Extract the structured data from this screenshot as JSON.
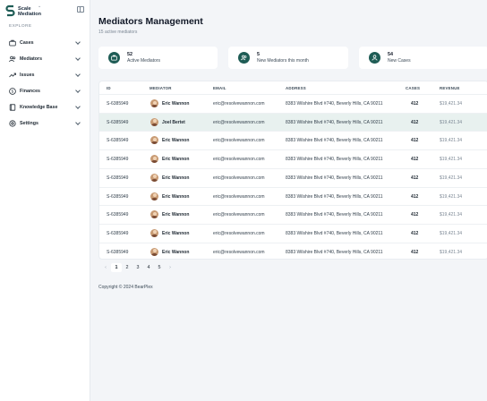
{
  "brand": {
    "line1": "Scale",
    "line2": "Mediation"
  },
  "sidebar": {
    "section_label": "EXPLORE",
    "items": [
      {
        "label": "Cases",
        "icon": "briefcase-icon"
      },
      {
        "label": "Mediators",
        "icon": "users-icon"
      },
      {
        "label": "Issues",
        "icon": "trending-icon"
      },
      {
        "label": "Finances",
        "icon": "dollar-icon"
      },
      {
        "label": "Knowledge Base",
        "icon": "book-icon"
      },
      {
        "label": "Settings",
        "icon": "gear-icon"
      }
    ]
  },
  "header": {
    "title": "Mediators Management",
    "subtitle": "15 active mediators"
  },
  "stats": [
    {
      "value": "52",
      "label": "Active Mediators",
      "icon": "briefcase-icon"
    },
    {
      "value": "5",
      "label": "New Mediators this month",
      "icon": "users-icon"
    },
    {
      "value": "54",
      "label": "New Cases",
      "icon": "person-icon"
    }
  ],
  "table": {
    "columns": {
      "id": "ID",
      "mediator": "MEDIATOR",
      "email": "EMAIL",
      "address": "ADDRESS",
      "cases": "CASES",
      "revenue": "REVENUE"
    },
    "rows": [
      {
        "id": "S-6385949",
        "name": "Eric Wannon",
        "email": "eric@resolvewannon.com",
        "address": "8383 Wilshire Blvd #740, Beverly Hills, CA 90211",
        "cases": "412",
        "revenue": "$19,421.34"
      },
      {
        "id": "S-6385949",
        "name": "Joel Bertet",
        "email": "eric@resolvewannon.com",
        "address": "8383 Wilshire Blvd #740, Beverly Hills, CA 90211",
        "cases": "412",
        "revenue": "$19,421.34"
      },
      {
        "id": "S-6385949",
        "name": "Eric Wannon",
        "email": "eric@resolvewannon.com",
        "address": "8383 Wilshire Blvd #740, Beverly Hills, CA 90211",
        "cases": "412",
        "revenue": "$19,421.34"
      },
      {
        "id": "S-6385949",
        "name": "Eric Wannon",
        "email": "eric@resolvewannon.com",
        "address": "8383 Wilshire Blvd #740, Beverly Hills, CA 90211",
        "cases": "412",
        "revenue": "$19,421.34"
      },
      {
        "id": "S-6385949",
        "name": "Eric Wannon",
        "email": "eric@resolvewannon.com",
        "address": "8383 Wilshire Blvd #740, Beverly Hills, CA 90211",
        "cases": "412",
        "revenue": "$19,421.34"
      },
      {
        "id": "S-6385949",
        "name": "Eric Wannon",
        "email": "eric@resolvewannon.com",
        "address": "8383 Wilshire Blvd #740, Beverly Hills, CA 90211",
        "cases": "412",
        "revenue": "$19,421.34"
      },
      {
        "id": "S-6385949",
        "name": "Eric Wannon",
        "email": "eric@resolvewannon.com",
        "address": "8383 Wilshire Blvd #740, Beverly Hills, CA 90211",
        "cases": "412",
        "revenue": "$19,421.34"
      },
      {
        "id": "S-6385949",
        "name": "Eric Wannon",
        "email": "eric@resolvewannon.com",
        "address": "8383 Wilshire Blvd #740, Beverly Hills, CA 90211",
        "cases": "412",
        "revenue": "$19,421.34"
      },
      {
        "id": "S-6385949",
        "name": "Eric Wannon",
        "email": "eric@resolvewannon.com",
        "address": "8383 Wilshire Blvd #740, Beverly Hills, CA 90211",
        "cases": "412",
        "revenue": "$19,421.34"
      }
    ],
    "highlighted_row": 1
  },
  "pagination": {
    "prev": "‹",
    "pages": [
      "1",
      "2",
      "3",
      "4",
      "5"
    ],
    "current": "1",
    "next": "›"
  },
  "footer": {
    "copyright": "Copyright © 2024 BearPlex"
  },
  "colors": {
    "accent": "#1e5c55",
    "highlight_row": "#e8f1ef",
    "page_bg": "#f3f5f8"
  }
}
